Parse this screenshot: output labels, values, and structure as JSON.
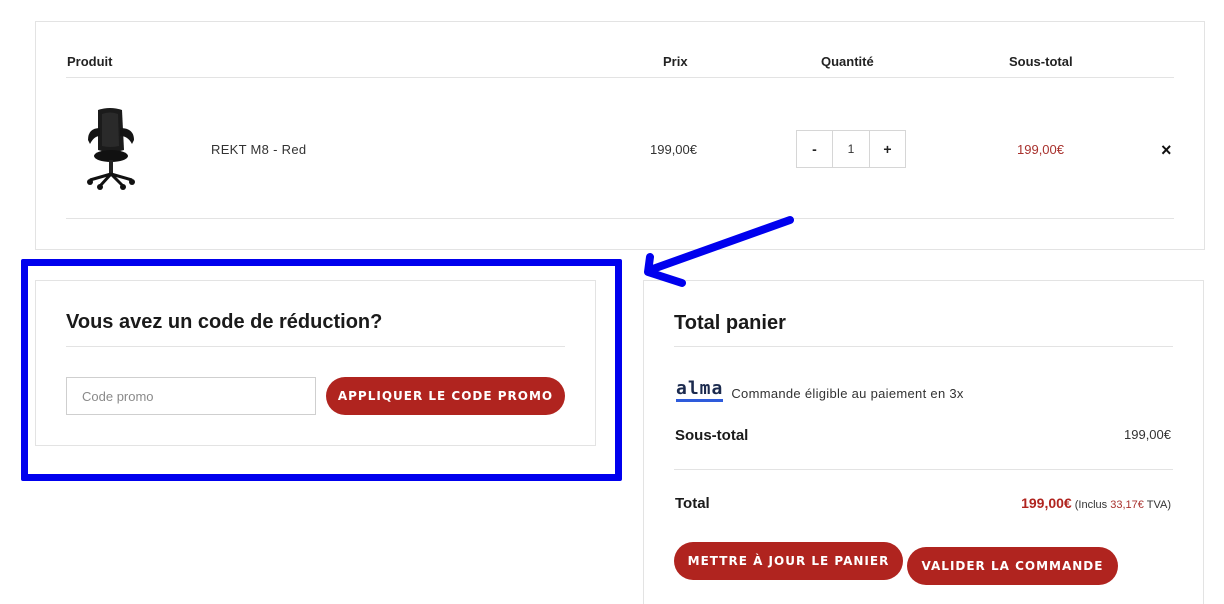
{
  "cart": {
    "headers": {
      "product": "Produit",
      "price": "Prix",
      "quantity": "Quantité",
      "subtotal": "Sous-total"
    },
    "items": [
      {
        "name": "REKT M8 - Red",
        "price": "199,00€",
        "quantity": "1",
        "subtotal": "199,00€",
        "image_icon": "office-chair-icon"
      }
    ],
    "qty_minus": "-",
    "qty_plus": "+",
    "remove": "×"
  },
  "coupon": {
    "title": "Vous avez un code de réduction?",
    "placeholder": "Code promo",
    "value": "",
    "apply_label": "Appliquer le code promo"
  },
  "totals": {
    "title": "Total panier",
    "alma_logo": "alma",
    "alma_text": "Commande éligible au paiement en 3x",
    "subtotal_label": "Sous-total",
    "subtotal_value": "199,00€",
    "total_label": "Total",
    "total_value": "199,00€",
    "tax_prefix": "(Inclus",
    "tax_value": "33,17€",
    "tax_suffix": "TVA)",
    "update_label": "Mettre à jour le panier",
    "checkout_label": "Valider la commande"
  },
  "colors": {
    "accent": "#b0241f",
    "highlight": "#0000ee",
    "border": "#e3e3e3"
  }
}
